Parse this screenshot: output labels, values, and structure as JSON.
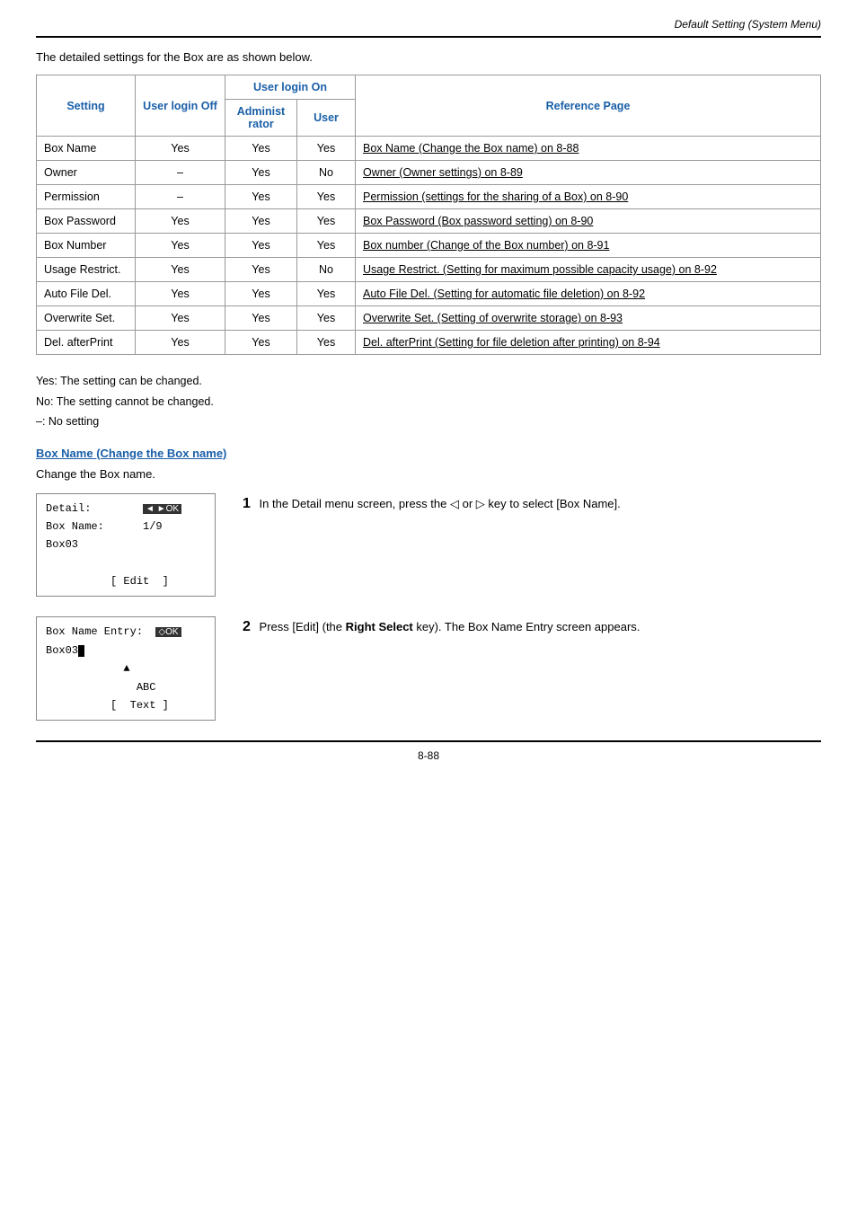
{
  "header": {
    "title": "Default Setting (System Menu)"
  },
  "intro": {
    "text": "The detailed settings for the Box are as shown below."
  },
  "table": {
    "col_setting": "Setting",
    "col_user_login_off": "User login Off",
    "col_user_login_on": "User login On",
    "col_administ": "Administ rator",
    "col_user": "User",
    "col_reference": "Reference Page",
    "rows": [
      {
        "setting": "Box Name",
        "login_off": "Yes",
        "admin": "Yes",
        "user": "Yes",
        "ref": "Box Name (Change the Box name) on 8-88"
      },
      {
        "setting": "Owner",
        "login_off": "–",
        "admin": "Yes",
        "user": "No",
        "ref": "Owner (Owner settings) on 8-89"
      },
      {
        "setting": "Permission",
        "login_off": "–",
        "admin": "Yes",
        "user": "Yes",
        "ref": "Permission (settings for the sharing of a Box) on 8-90"
      },
      {
        "setting": "Box Password",
        "login_off": "Yes",
        "admin": "Yes",
        "user": "Yes",
        "ref": "Box Password (Box password setting) on 8-90"
      },
      {
        "setting": "Box Number",
        "login_off": "Yes",
        "admin": "Yes",
        "user": "Yes",
        "ref": "Box number (Change of the Box number) on 8-91"
      },
      {
        "setting": "Usage Restrict.",
        "login_off": "Yes",
        "admin": "Yes",
        "user": "No",
        "ref": "Usage Restrict. (Setting for maximum possible capacity usage) on 8-92"
      },
      {
        "setting": "Auto File Del.",
        "login_off": "Yes",
        "admin": "Yes",
        "user": "Yes",
        "ref": "Auto File Del. (Setting for automatic file deletion) on 8-92"
      },
      {
        "setting": "Overwrite Set.",
        "login_off": "Yes",
        "admin": "Yes",
        "user": "Yes",
        "ref": "Overwrite Set. (Setting of overwrite storage) on 8-93"
      },
      {
        "setting": "Del. afterPrint",
        "login_off": "Yes",
        "admin": "Yes",
        "user": "Yes",
        "ref": "Del. afterPrint (Setting for file deletion after printing) on 8-94"
      }
    ]
  },
  "legend": {
    "yes": "Yes: The setting can be changed.",
    "no": "No:   The setting cannot be changed.",
    "dash": "–:    No setting"
  },
  "section": {
    "heading": "Box Name (Change the Box name)",
    "change_text": "Change the Box name.",
    "screen1": {
      "line1": "Detail:          ◄ ►",
      "line2": "Box Name:         1/9",
      "line3": "Box03",
      "line4": "",
      "line5": "          [ Edit ]"
    },
    "screen2": {
      "line1": "Box Name Entry:   ◇",
      "line2": "Box03",
      "line3": "",
      "line4": "            ▲",
      "line5": "              ABC",
      "line6": "          [  Text ]"
    },
    "step1": {
      "number": "1",
      "text": "In the Detail menu screen, press the ◁ or ▷ key to select [Box Name]."
    },
    "step2": {
      "number": "2",
      "text_before": "Press [Edit] (the ",
      "bold": "Right Select",
      "text_after": " key). The Box Name Entry screen appears."
    }
  },
  "footer": {
    "page": "8-88"
  }
}
